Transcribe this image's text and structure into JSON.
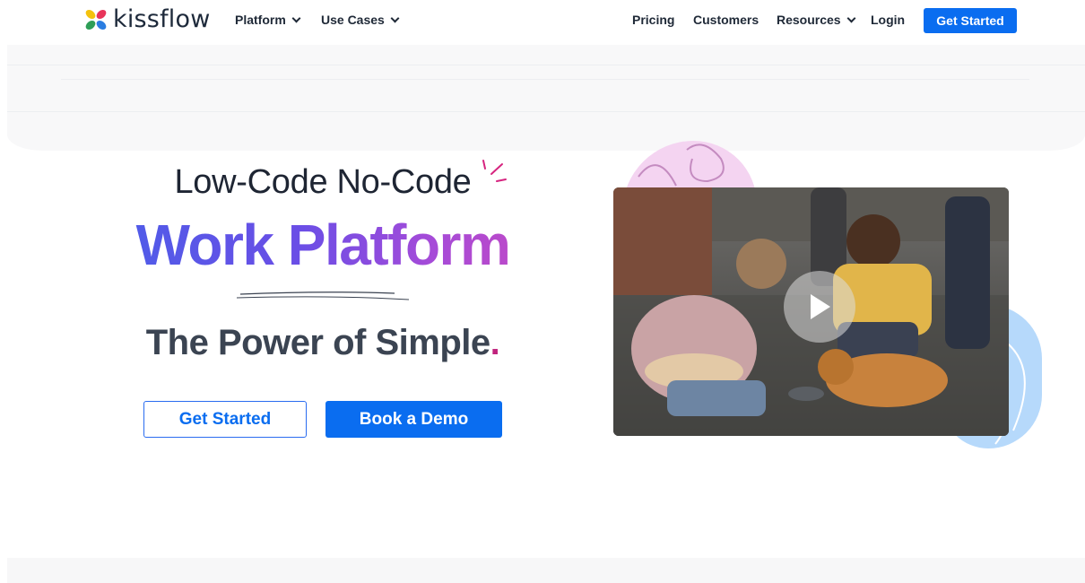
{
  "nav": {
    "logo_text": "kissflow",
    "platform": "Platform",
    "use_cases": "Use Cases",
    "pricing": "Pricing",
    "customers": "Customers",
    "resources": "Resources",
    "login": "Login",
    "cta": "Get Started"
  },
  "hero": {
    "subtitle": "Low-Code No-Code",
    "title": "Work Platform",
    "tagline": "The Power of Simple",
    "tagline_dot": ".",
    "primary_outline_button": "Get Started",
    "primary_solid_button": "Book a Demo"
  },
  "video": {
    "play_icon": "play-icon"
  },
  "colors": {
    "brand_blue": "#0a6df0",
    "gradient_start": "#4d5de8",
    "gradient_end": "#c14ac6",
    "accent_pink": "#c0237d"
  }
}
